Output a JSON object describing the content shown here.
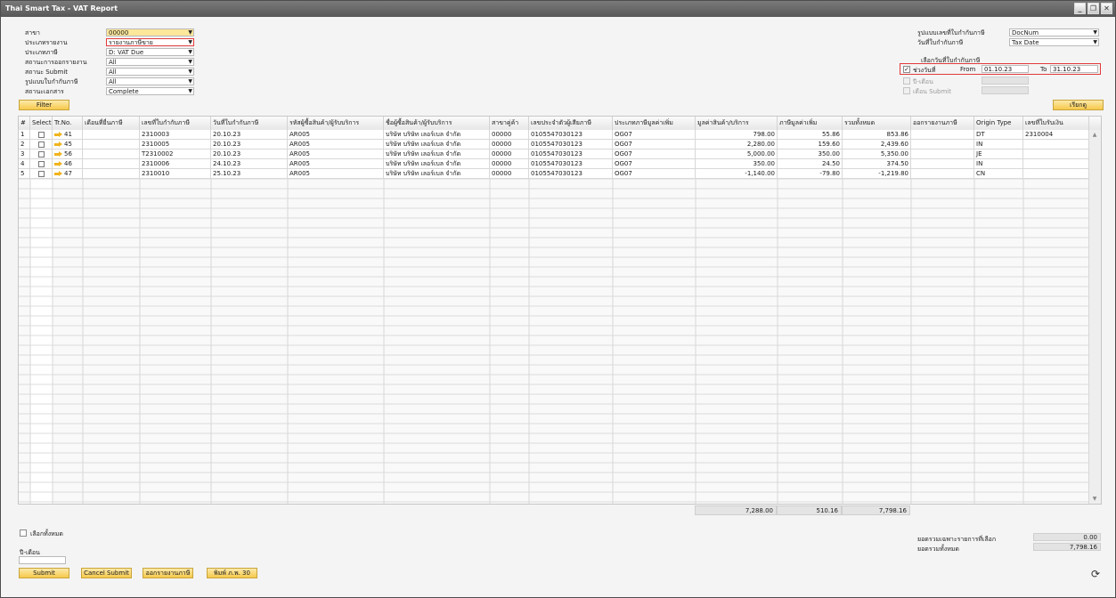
{
  "window": {
    "title": "Thai Smart Tax - VAT Report"
  },
  "filters": {
    "branch": {
      "label": "สาขา",
      "value": "00000"
    },
    "report_type": {
      "label": "ประเภทรายงาน",
      "value": "รายงานภาษีขาย"
    },
    "tax_type": {
      "label": "ประเภทภาษี",
      "value": "D: VAT Due"
    },
    "issue_status": {
      "label": "สถานะการออกรายงาน",
      "value": "All"
    },
    "submit_status": {
      "label": "สถานะ Submit",
      "value": "All"
    },
    "invoice_format": {
      "label": "รูปแบบใบกำกับภาษี",
      "value": "All"
    },
    "doc_status": {
      "label": "สถานะเอกสาร",
      "value": "Complete"
    }
  },
  "right_filters": {
    "doc_number_format": {
      "label": "รูปแบบเลขที่ใบกำกับภาษี",
      "value": "DocNum"
    },
    "tax_date": {
      "label": "วันที่ใบกำกับภาษี",
      "value": "Tax Date"
    },
    "date_section_title": "เลือกวันที่ใบกำกับภาษี",
    "date_range": {
      "label": "ช่วงวันที่",
      "checked": true,
      "from_label": "From",
      "from_value": "01.10.23",
      "to_label": "To",
      "to_value": "31.10.23"
    },
    "year_month": {
      "label": "ปี-เดือน",
      "checked": false
    },
    "submit_month": {
      "label": "เดือน Submit",
      "checked": false
    }
  },
  "buttons": {
    "filter": "Filter",
    "select": "เรียกดู",
    "submit": "Submit",
    "cancel_submit": "Cancel Submit",
    "issue_report": "ออกรายงานภาษี",
    "print_form": "พิมพ์ ภ.พ. 30"
  },
  "table": {
    "columns": [
      "#",
      "Select",
      "Tr.No.",
      "เดือนที่ยื่นภาษี",
      "เลขที่ใบกำกับภาษี",
      "วันที่ใบกำกับภาษี",
      "รหัสผู้ซื้อสินค้า/ผู้รับบริการ",
      "ชื่อผู้ซื้อสินค้า/ผู้รับบริการ",
      "สาขาคู่ค้า",
      "เลขประจำตัวผู้เสียภาษี",
      "ประเภทภาษีมูลค่าเพิ่ม",
      "มูลค่าสินค้า/บริการ",
      "ภาษีมูลค่าเพิ่ม",
      "รวมทั้งหมด",
      "ออกรายงานภาษี",
      "Origin Type",
      "เลขที่ใบรับเงิน"
    ],
    "rows": [
      {
        "num": "1",
        "trno": "41",
        "month": "",
        "invoice": "2310003",
        "date": "20.10.23",
        "code": "AR005",
        "name": "บริษัท บริษัท เลอร์เบล จำกัด",
        "branch": "00000",
        "taxid": "0105547030123",
        "vattype": "OG07",
        "amount": "798.00",
        "vat": "55.86",
        "total": "853.86",
        "issued": "",
        "origin": "DT",
        "receipt": "2310004"
      },
      {
        "num": "2",
        "trno": "45",
        "month": "",
        "invoice": "2310005",
        "date": "20.10.23",
        "code": "AR005",
        "name": "บริษัท บริษัท เลอร์เบล จำกัด",
        "branch": "00000",
        "taxid": "0105547030123",
        "vattype": "OG07",
        "amount": "2,280.00",
        "vat": "159.60",
        "total": "2,439.60",
        "issued": "",
        "origin": "IN",
        "receipt": ""
      },
      {
        "num": "3",
        "trno": "56",
        "month": "",
        "invoice": "T2310002",
        "date": "20.10.23",
        "code": "AR005",
        "name": "บริษัท บริษัท เลอร์เบล จำกัด",
        "branch": "00000",
        "taxid": "0105547030123",
        "vattype": "OG07",
        "amount": "5,000.00",
        "vat": "350.00",
        "total": "5,350.00",
        "issued": "",
        "origin": "JE",
        "receipt": ""
      },
      {
        "num": "4",
        "trno": "46",
        "month": "",
        "invoice": "2310006",
        "date": "24.10.23",
        "code": "AR005",
        "name": "บริษัท บริษัท เลอร์เบล จำกัด",
        "branch": "00000",
        "taxid": "0105547030123",
        "vattype": "OG07",
        "amount": "350.00",
        "vat": "24.50",
        "total": "374.50",
        "issued": "",
        "origin": "IN",
        "receipt": ""
      },
      {
        "num": "5",
        "trno": "47",
        "month": "",
        "invoice": "2310010",
        "date": "25.10.23",
        "code": "AR005",
        "name": "บริษัท บริษัท เลอร์เบล จำกัด",
        "branch": "00000",
        "taxid": "0105547030123",
        "vattype": "OG07",
        "amount": "-1,140.00",
        "vat": "-79.80",
        "total": "-1,219.80",
        "issued": "",
        "origin": "CN",
        "receipt": ""
      }
    ],
    "totals": {
      "amount": "7,288.00",
      "vat": "510.16",
      "total": "7,798.16"
    }
  },
  "bottom": {
    "select_all": "เลือกทั้งหมด",
    "year_month_label": "ปี-เดือน",
    "selected_total_label": "ยอดรวมเฉพาะรายการที่เลือก",
    "selected_total_value": "0.00",
    "grand_total_label": "ยอดรวมทั้งหมด",
    "grand_total_value": "7,798.16"
  },
  "icons": {
    "row_link": "arrow-right-icon",
    "refresh": "refresh-icon"
  },
  "colors": {
    "accent": "#f6c94c",
    "highlight_border": "#e23b3b",
    "input_yellow": "#fde79a"
  }
}
